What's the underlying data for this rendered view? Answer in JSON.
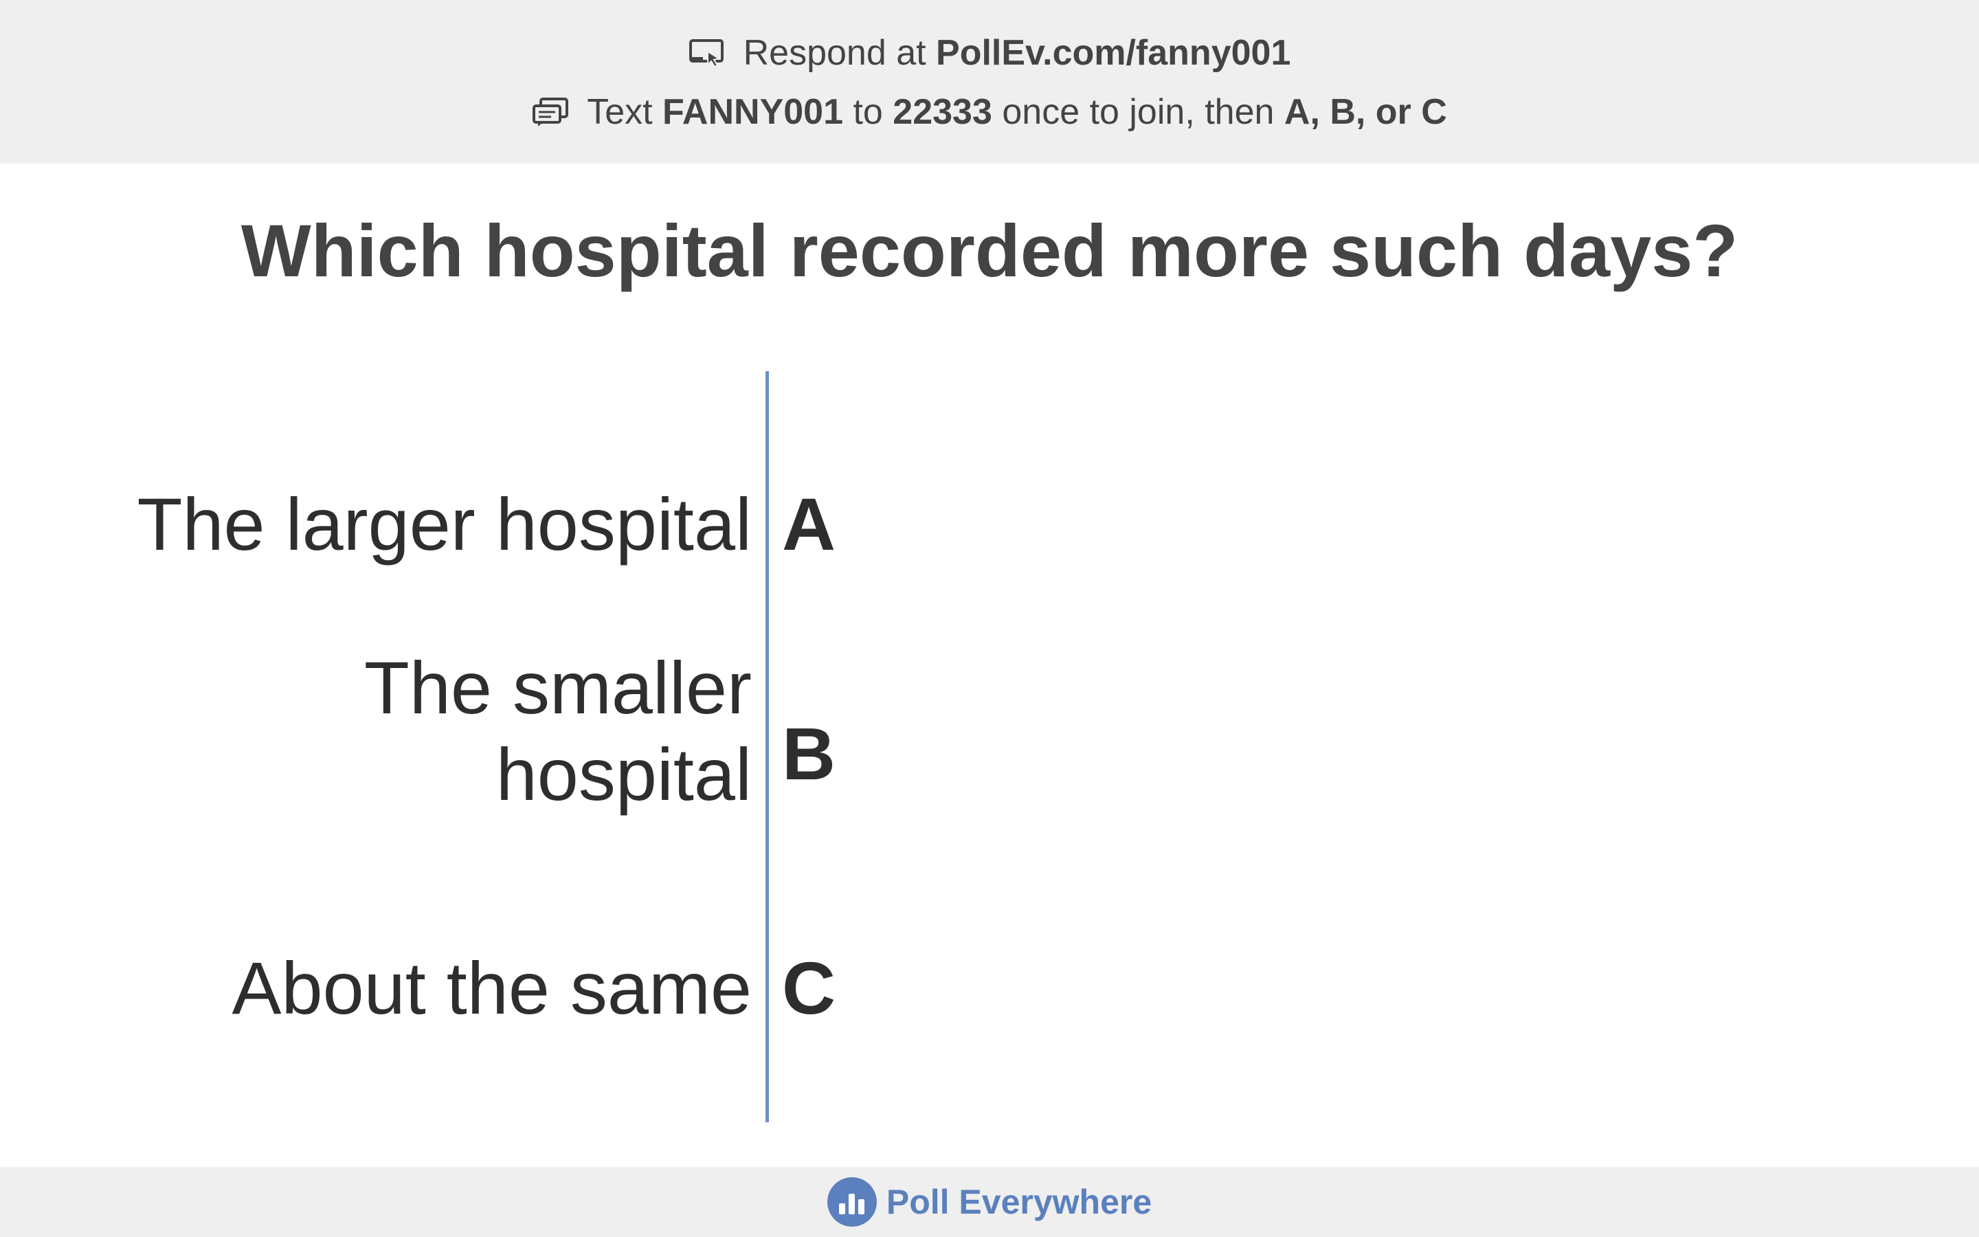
{
  "instructions": {
    "respond_prefix": "Respond at",
    "respond_url": "PollEv.com/fanny001",
    "text_prefix": "Text",
    "text_code": "FANNY001",
    "text_to": "to",
    "text_number": "22333",
    "text_middle": "once to join, then",
    "text_choices": "A, B, or C"
  },
  "question": "Which hospital recorded more such days?",
  "options": [
    {
      "label": "The larger hospital",
      "letter": "A"
    },
    {
      "label_line1": "The smaller",
      "label_line2": "hospital",
      "letter": "B"
    },
    {
      "label": "About the same",
      "letter": "C"
    }
  ],
  "footer": {
    "brand": "Poll Everywhere"
  },
  "colors": {
    "axis": "#6b8fc7",
    "brand": "#5b80bd",
    "bar_background": "#efefef"
  },
  "icons": [
    "screen-cursor-icon",
    "text-message-icon",
    "poll-everywhere-logo-icon"
  ]
}
